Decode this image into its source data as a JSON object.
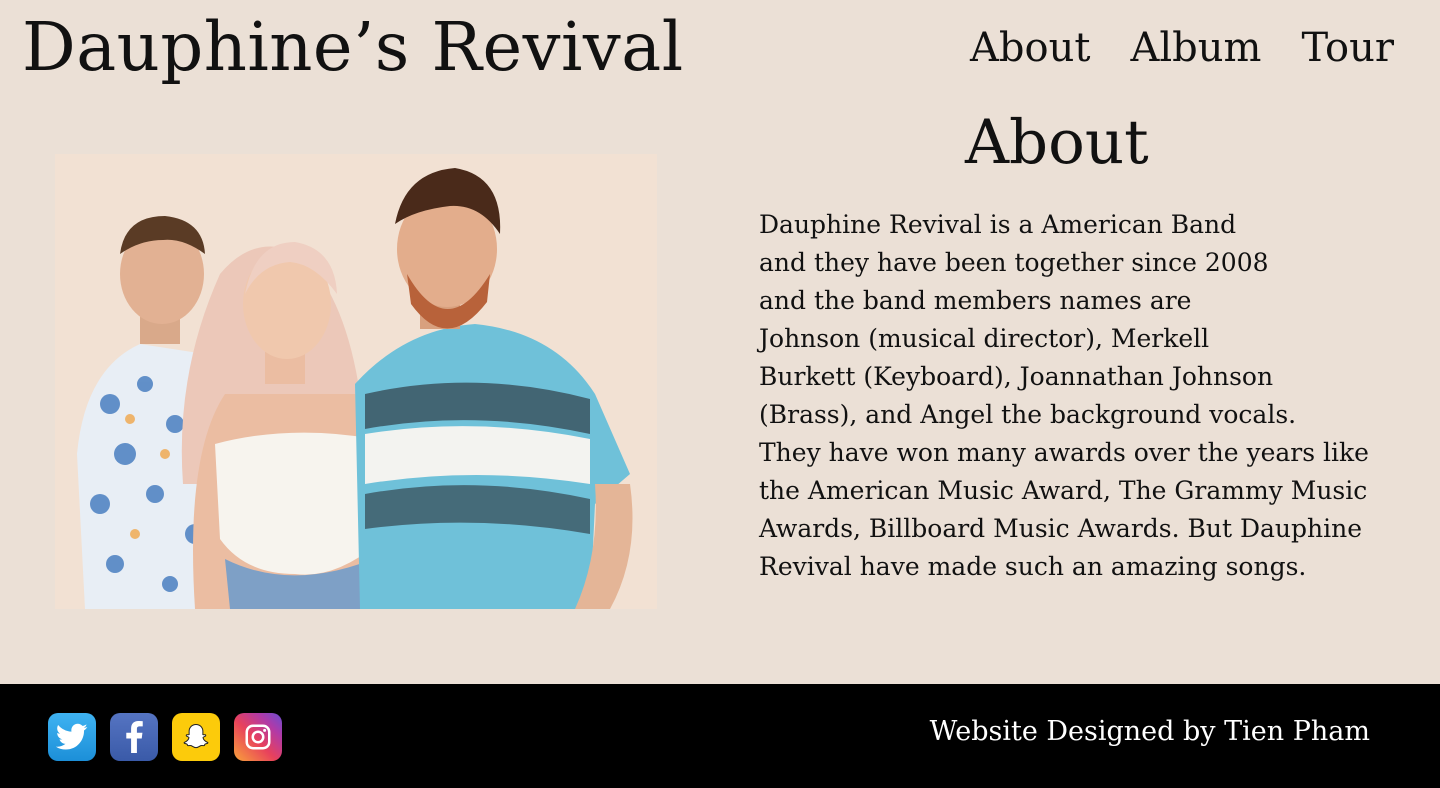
{
  "header": {
    "site_title": "Dauphine’s Revival",
    "nav": [
      {
        "label": "About"
      },
      {
        "label": "Album"
      },
      {
        "label": "Tour"
      }
    ]
  },
  "about": {
    "heading": "About",
    "lines": [
      "Dauphine Revival is a American Band",
      "and they have been together since 2008",
      "and the band members names are",
      "Johnson (musical director), Merkell",
      "Burkett (Keyboard), Joannathan Johnson",
      "(Brass), and Angel the background vocals.",
      "They have won many awards over the years like",
      "the American Music Award, The Grammy Music",
      "Awards, Billboard Music Awards. But Dauphine",
      "Revival have made such an amazing songs."
    ]
  },
  "footer": {
    "social_icons": [
      "twitter-icon",
      "facebook-icon",
      "snapchat-icon",
      "instagram-icon"
    ],
    "credit": "Website Designed by Tien Pham"
  },
  "colors": {
    "page_background": "#ebe0d6",
    "footer_background": "#000000",
    "twitter": "#1da1f2",
    "facebook": "#3b5998",
    "snapchat": "#fffc00"
  }
}
